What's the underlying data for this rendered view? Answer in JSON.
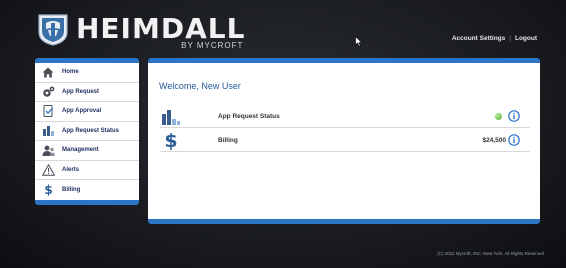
{
  "brand": {
    "name": "HEIMDALL",
    "subtitle": "BY MYCROFT"
  },
  "header": {
    "links": [
      "Account Settings",
      "Logout"
    ],
    "separator": "|"
  },
  "sidebar": {
    "items": [
      {
        "label": "Home",
        "icon": "home-icon"
      },
      {
        "label": "App Request",
        "icon": "gears-icon"
      },
      {
        "label": "App Approval",
        "icon": "document-check-icon"
      },
      {
        "label": "App Request Status",
        "icon": "bar-chart-icon"
      },
      {
        "label": "Management",
        "icon": "users-icon"
      },
      {
        "label": "Alerts",
        "icon": "warning-icon"
      },
      {
        "label": "Billing",
        "icon": "dollar-icon"
      }
    ]
  },
  "main": {
    "welcome": "Welcome, New User",
    "rows": [
      {
        "label": "App Request Status",
        "icon": "bar-chart-icon",
        "status": "green"
      },
      {
        "label": "Billing",
        "icon": "dollar-icon",
        "amount": "$24,500"
      }
    ]
  },
  "footer": {
    "copyright": "(C) 2011 Mycroft, INC. New York. All Rights Reserved"
  },
  "colors": {
    "accent": "#2b74c6",
    "nav_text": "#1b2d5e",
    "welcome_text": "#255d9a",
    "status_ok": "#4caa2e"
  }
}
